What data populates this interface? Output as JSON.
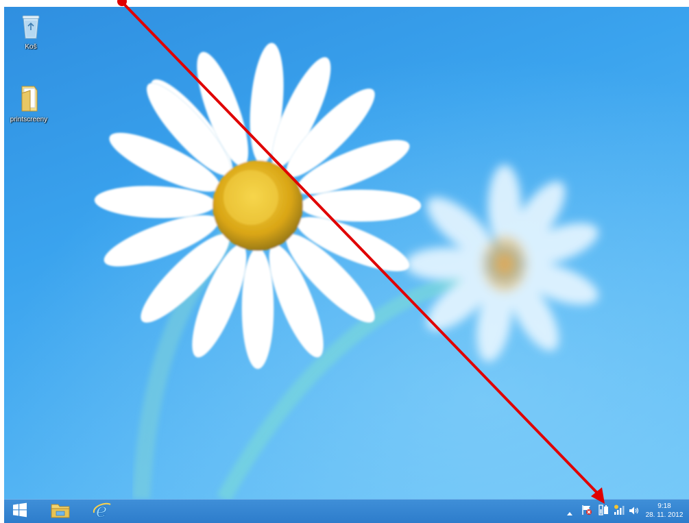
{
  "desktop": {
    "icons": [
      {
        "label": "Koš",
        "icon": "recycle-bin-icon"
      },
      {
        "label": "printscreeny",
        "icon": "folder-icon"
      }
    ],
    "wallpaper": "daisy-flowers-on-blue"
  },
  "taskbar": {
    "pinned": [
      {
        "name": "start",
        "icon": "windows-logo-icon"
      },
      {
        "name": "file-explorer",
        "icon": "folder-icon"
      },
      {
        "name": "internet-explorer",
        "icon": "ie-icon"
      }
    ],
    "tray": {
      "icons": [
        "show-hidden-icons-chevron",
        "action-center-flag-icon",
        "power-battery-icon",
        "network-signal-icon",
        "volume-icon"
      ],
      "time": "9:18",
      "date": "28. 11. 2012"
    }
  },
  "annotation": {
    "type": "red-arrow",
    "color": "#e00000",
    "points_to": "network-signal-icon"
  },
  "colors": {
    "taskbar": "#2d7ccb",
    "desktop_sky": "#3aa3ee",
    "arrow": "#e00000"
  }
}
